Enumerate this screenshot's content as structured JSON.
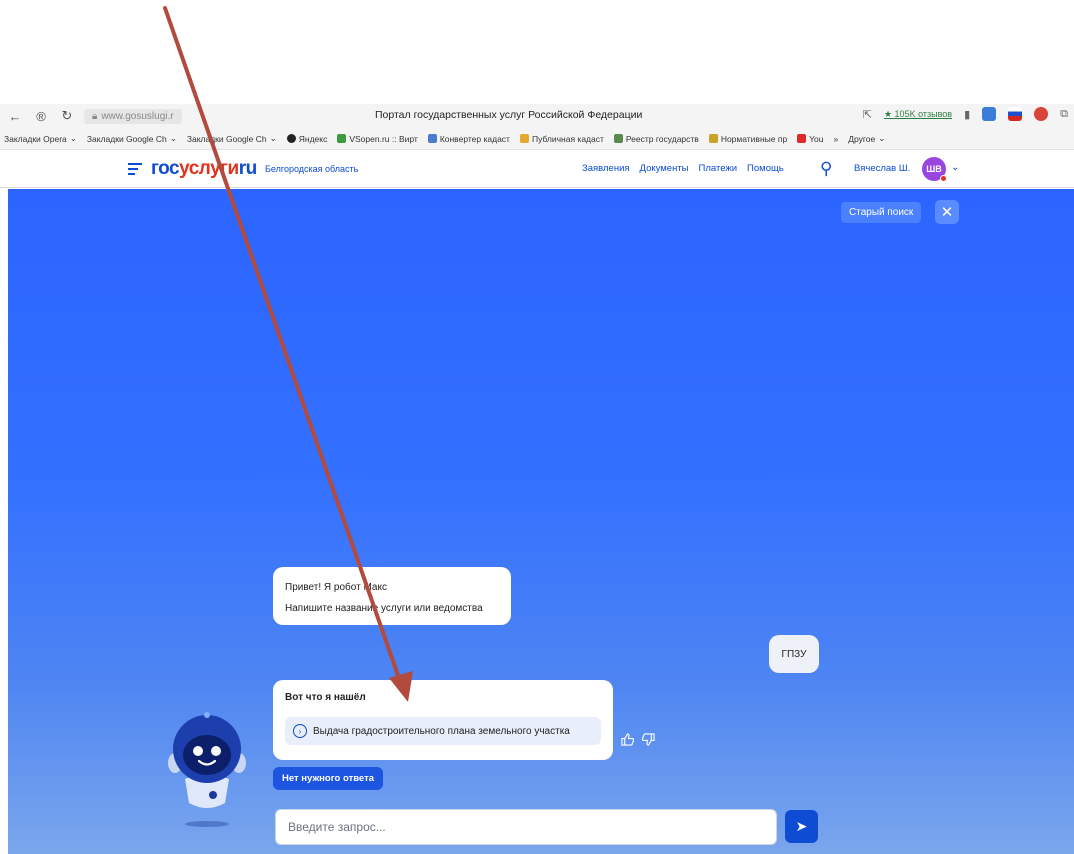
{
  "browser": {
    "url": "www.gosuslugi.r",
    "tab_title": "Портал государственных услуг Российской Федерации",
    "reviews": "★ 105K отзывов",
    "bookmarks": [
      "Закладки Opera",
      "Закладки Google Ch",
      "Закладки Google Ch",
      "Яндекс",
      "VSopen.ru :: Вирт",
      "Конвертер кадаст",
      "Публичная кадаст",
      "Реестр государств",
      "Нормативные пр",
      "You",
      "»",
      "Другое"
    ]
  },
  "header": {
    "logo_part1": "гос",
    "logo_part2": "услуги",
    "logo_part3": "ru",
    "region": "Белгородская область",
    "nav": [
      "Заявления",
      "Документы",
      "Платежи",
      "Помощь"
    ],
    "user_name": "Вячеслав Ш.",
    "avatar_initials": "ШВ"
  },
  "search_panel": {
    "old_search_label": "Старый поиск",
    "close_label": "✕"
  },
  "chat": {
    "greeting_line1": "Привет! Я робот Макс",
    "greeting_line2": "Напишите название услуги или ведомства",
    "user_message": "ГПЗУ",
    "result_title": "Вот что я нашёл",
    "result_item": "Выдача градостроительного плана земельного участка",
    "no_answer_button": "Нет нужного ответа",
    "input_placeholder": "Введите запрос..."
  },
  "colors": {
    "brand_blue": "#0d4cd3",
    "brand_red": "#e0331f",
    "background_blue": "#2b64ff",
    "annotation_arrow": "#b24a3e"
  }
}
